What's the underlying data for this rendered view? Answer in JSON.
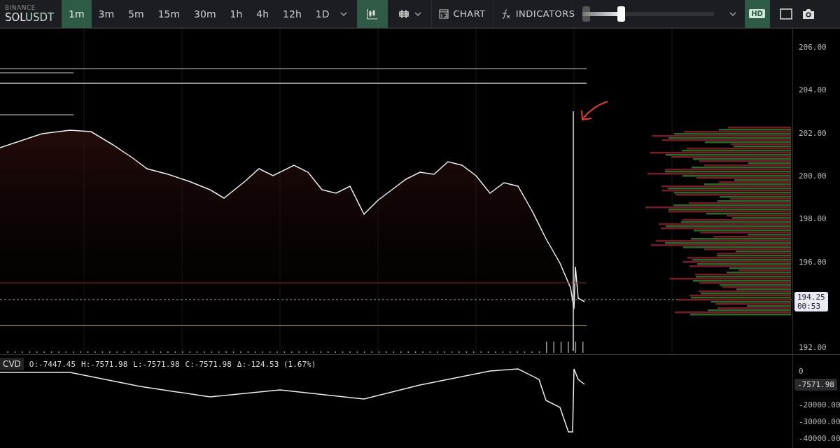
{
  "symbol": {
    "exchange": "BINANCE",
    "base": "SOL",
    "quote": "USDT"
  },
  "timeframes": [
    {
      "label": "1m",
      "selected": true
    },
    {
      "label": "3m",
      "selected": false
    },
    {
      "label": "5m",
      "selected": false
    },
    {
      "label": "15m",
      "selected": false
    },
    {
      "label": "30m",
      "selected": false
    },
    {
      "label": "1h",
      "selected": false
    },
    {
      "label": "4h",
      "selected": false
    },
    {
      "label": "12h",
      "selected": false
    },
    {
      "label": "1D",
      "selected": false
    }
  ],
  "chart_type_button": {
    "selected": true
  },
  "buttons": [
    {
      "kind": "chart",
      "label": "CHART"
    },
    {
      "kind": "indicators",
      "label": "INDICATORS"
    }
  ],
  "zoom_slider": {
    "level": 0.3
  },
  "hd_button": {
    "label": "HD",
    "selected": true
  },
  "price_axis": {
    "ticks": [
      "206.00",
      "204.00",
      "202.00",
      "200.00",
      "198.00",
      "196.00",
      "192.00"
    ],
    "current_price": "194.25",
    "countdown": "00:53"
  },
  "cvd": {
    "name": "CVD",
    "stats": [
      {
        "key": "O:",
        "value": "-7447.45"
      },
      {
        "key": "H:",
        "value": "-7571.98"
      },
      {
        "key": "L:",
        "value": "-7571.98"
      },
      {
        "key": "C:",
        "value": "-7571.98"
      },
      {
        "key": "Δ:",
        "value": "-124.53 (1.67%)"
      }
    ],
    "ticks": [
      "0",
      "-20000.00",
      "-30000.00",
      "-40000.00"
    ],
    "current": "-7571.98"
  }
}
